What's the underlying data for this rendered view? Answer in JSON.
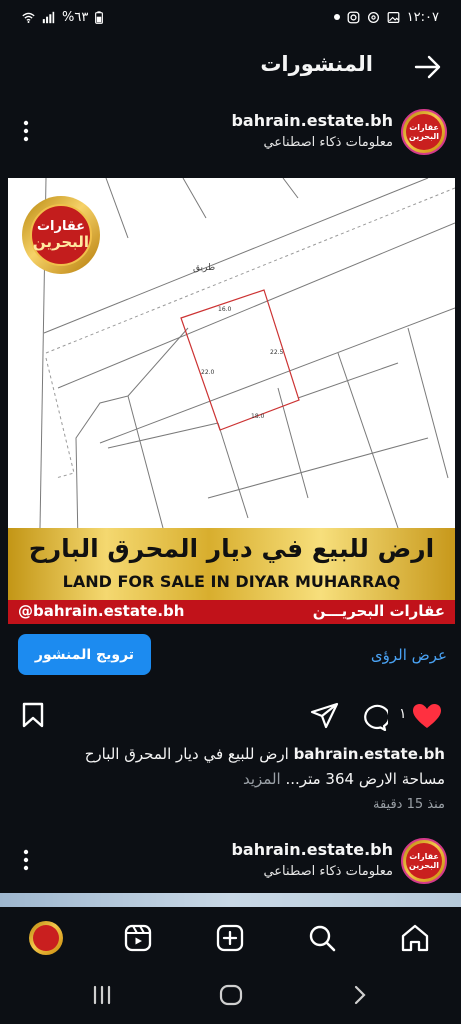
{
  "status": {
    "time": "١٢:٠٧",
    "battery": "%٦٣"
  },
  "header": {
    "title": "المنشورات"
  },
  "posts": [
    {
      "username": "bahrain.estate.bh",
      "subtitle": "معلومات ذكاء اصطناعي",
      "avatar_text_1": "عقارات",
      "avatar_text_2": "البحرين",
      "image": {
        "road_label": "طريق",
        "dimension_top": "16.0",
        "dimension_bottom": "18.0",
        "dimension_left": "22.0",
        "dimension_right": "22.5",
        "logo_line1": "عقارات",
        "logo_line2": "البحرين",
        "headline_ar": "ارض للبيع في ديار المحرق البارح",
        "headline_en": "LAND FOR SALE IN DIYAR MUHARRAQ",
        "handle": "@bahrain.estate.bh",
        "brand": "عقارات البحريـــن"
      },
      "promote_label": "ترويج المنشور",
      "insights_label": "عرض الرؤى",
      "like_count": "١",
      "caption_user": "bahrain.estate.bh",
      "caption_text": " ارض للبيع في ديار المحرق البارح",
      "caption_line2": "مساحة الارض 364 متر...",
      "caption_more": " المزيد",
      "timestamp": "منذ 15 دقيقة"
    },
    {
      "username": "bahrain.estate.bh",
      "subtitle": "معلومات ذكاء اصطناعي",
      "avatar_text_1": "عقارات",
      "avatar_text_2": "البحرين"
    }
  ],
  "colors": {
    "background": "#0c0f14",
    "accent_blue": "#1c8bf0",
    "link_blue": "#4aa3f5",
    "like_red": "#ff3040",
    "gold": "#f4d870",
    "brand_red": "#c1121a"
  },
  "icons": {
    "back": "arrow-right-icon",
    "more": "more-vertical-icon",
    "like": "heart-filled-icon",
    "comment": "comment-icon",
    "share": "send-icon",
    "save": "bookmark-icon",
    "nav": [
      "home-icon",
      "search-icon",
      "create-icon",
      "reels-icon",
      "profile-avatar"
    ],
    "system": [
      "back-chevron-icon",
      "home-circle-icon",
      "recents-icon"
    ]
  }
}
